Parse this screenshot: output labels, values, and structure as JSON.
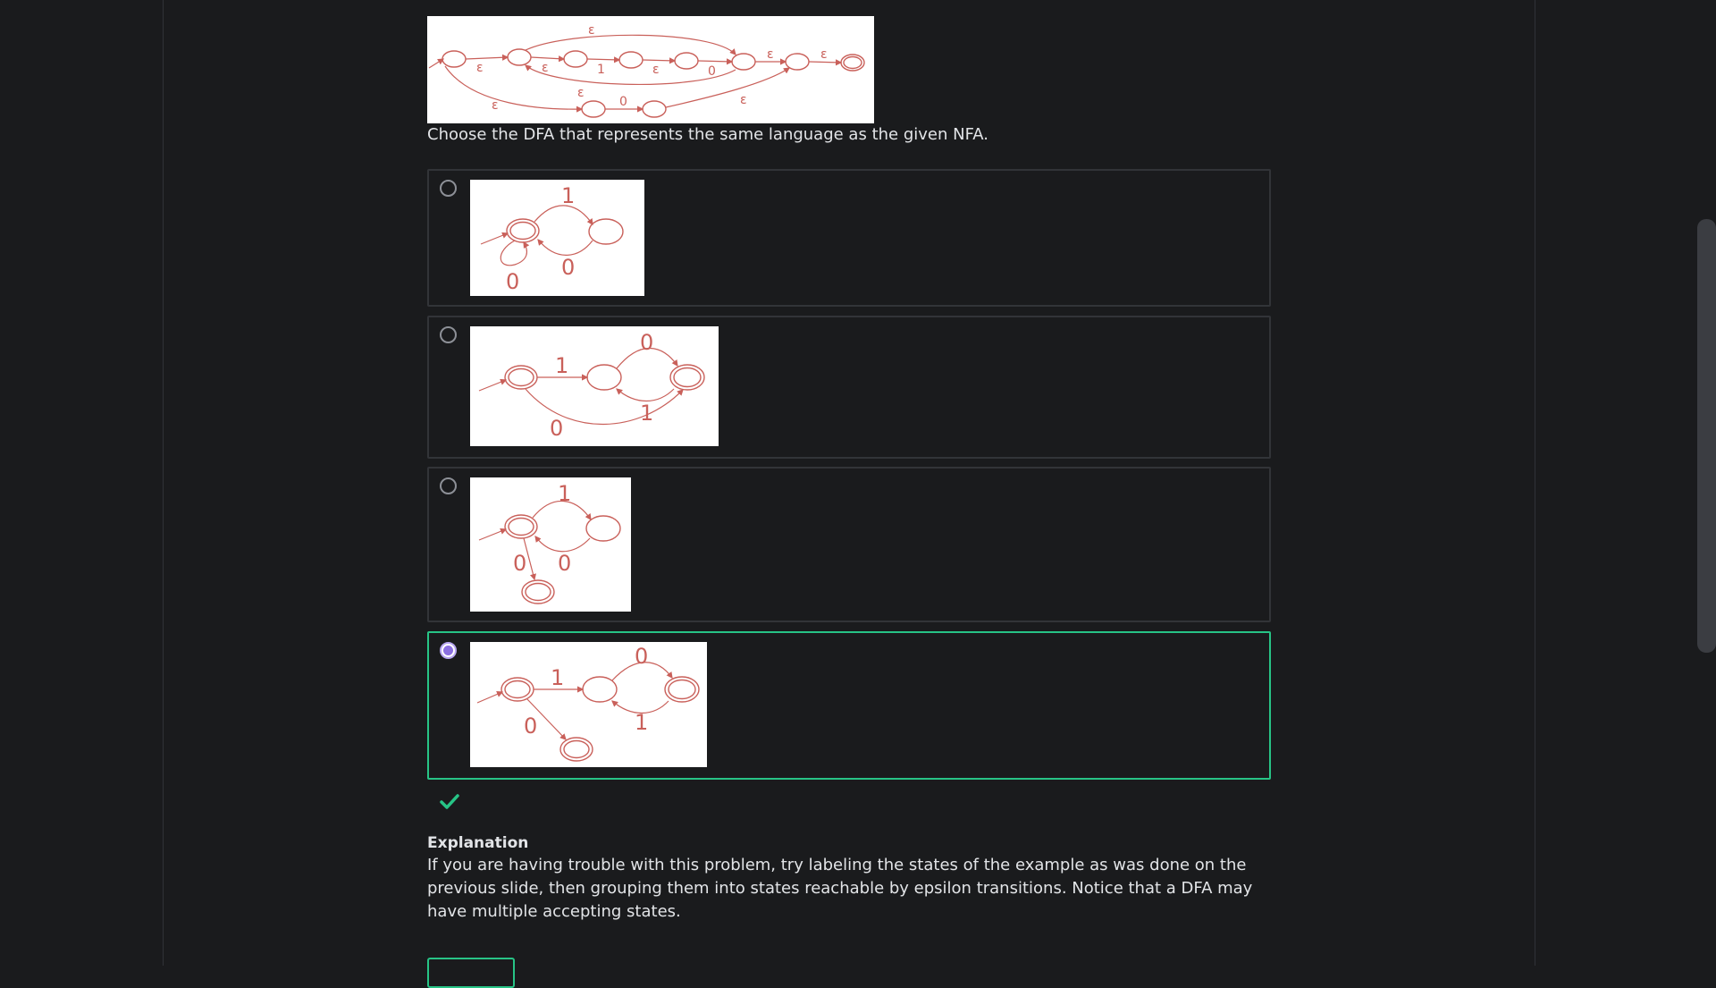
{
  "question": {
    "prompt": "Choose the DFA that represents the same language as the given NFA.",
    "nfa_alt": "NFA diagram with epsilon transitions"
  },
  "nfa_labels": {
    "eps": "ε",
    "one": "1",
    "zero": "0"
  },
  "options": [
    {
      "selected": false,
      "labels": [
        "1",
        "0",
        "0"
      ]
    },
    {
      "selected": false,
      "labels": [
        "1",
        "0",
        "0",
        "1"
      ]
    },
    {
      "selected": false,
      "labels": [
        "1",
        "0",
        "0"
      ]
    },
    {
      "selected": true,
      "labels": [
        "1",
        "0",
        "0",
        "1"
      ]
    }
  ],
  "result": {
    "icon": "checkmark-icon",
    "status": "correct",
    "color": "#27c486"
  },
  "explanation": {
    "title": "Explanation",
    "body": "If you are having trouble with this problem, try labeling the states of the example as was done on the previous slide, then grouping them into states reachable by epsilon transitions. Notice that a DFA may have multiple accepting states."
  },
  "colors": {
    "background": "#1a1b1d",
    "accent": "#27c486",
    "radio_selected": "#8b6fe0",
    "diagram": "#c9605a"
  }
}
